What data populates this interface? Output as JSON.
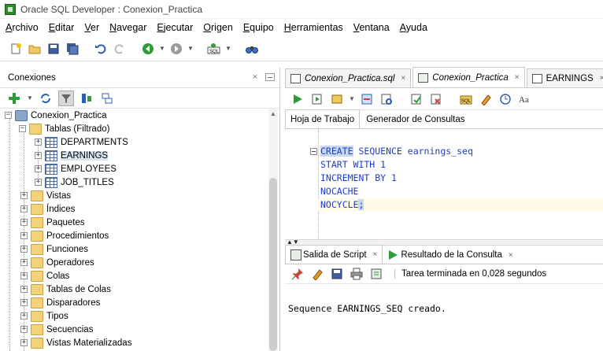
{
  "window": {
    "title": "Oracle SQL Developer : Conexion_Practica"
  },
  "menu": [
    {
      "label": "Archivo",
      "u": "A",
      "rest": "rchivo"
    },
    {
      "label": "Editar",
      "u": "E",
      "rest": "ditar"
    },
    {
      "label": "Ver",
      "u": "V",
      "rest": "er"
    },
    {
      "label": "Navegar",
      "u": "N",
      "rest": "avegar"
    },
    {
      "label": "Ejecutar",
      "u": "E",
      "rest": "jecutar"
    },
    {
      "label": "Origen",
      "u": "O",
      "rest": "rigen"
    },
    {
      "label": "Equipo",
      "u": "E",
      "rest": "quipo"
    },
    {
      "label": "Herramientas",
      "u": "H",
      "rest": "erramientas"
    },
    {
      "label": "Ventana",
      "u": "V",
      "rest": "entana"
    },
    {
      "label": "Ayuda",
      "u": "A",
      "rest": "yuda"
    }
  ],
  "toolbar": {
    "icons": [
      "new-icon",
      "open-icon",
      "save-icon",
      "save-all-icon",
      "undo-icon",
      "redo-icon",
      "back-icon",
      "forward-icon",
      "sql-icon",
      "binoculars-icon"
    ]
  },
  "connections": {
    "header": "Conexiones",
    "close": "×",
    "tree": {
      "root": "Conexion_Practica",
      "tables_folder": "Tablas (Filtrado)",
      "tables": [
        "DEPARTMENTS",
        "EARNINGS",
        "EMPLOYEES",
        "JOB_TITLES"
      ],
      "selected_table": "EARNINGS",
      "folders": [
        "Vistas",
        "Índices",
        "Paquetes",
        "Procedimientos",
        "Funciones",
        "Operadores",
        "Colas",
        "Tablas de Colas",
        "Disparadores",
        "Tipos",
        "Secuencias",
        "Vistas Materializadas"
      ]
    }
  },
  "editor": {
    "tabs": [
      {
        "label": "Conexion_Practica.sql",
        "italic": true,
        "active": false
      },
      {
        "label": "Conexion_Practica",
        "italic": true,
        "active": true
      },
      {
        "label": "EARNINGS",
        "italic": false,
        "active": false
      }
    ],
    "close": "×",
    "subtabs": {
      "worksheet": "Hoja de Trabajo",
      "query_builder": "Generador de Consultas"
    },
    "code": {
      "line1_kw": "CREATE",
      "line1_rest": " SEQUENCE earnings_seq",
      "line2": "START WITH 1",
      "line3": "INCREMENT BY 1",
      "line4": "NOCACHE",
      "line5_text": "NOCYCLE",
      "line5_semi": ";"
    }
  },
  "output": {
    "tabs": {
      "script": "Salida de Script",
      "result": "Resultado de la Consulta"
    },
    "close": "×",
    "status": "Tarea terminada en 0,028 segundos",
    "message": "Sequence EARNINGS_SEQ creado."
  }
}
